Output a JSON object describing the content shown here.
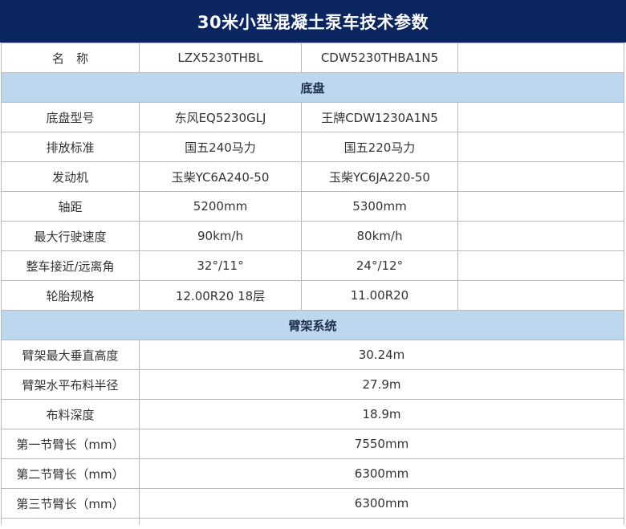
{
  "title": "30米小型混凝土泵车技术参数",
  "header": {
    "name_label": "名　称",
    "model1": "LZX5230THBL",
    "model2": "CDW5230THBA1N5"
  },
  "sections": {
    "chassis": "底盘",
    "boom": "臂架系统"
  },
  "chassis_rows": [
    {
      "label": "底盘型号",
      "v1": "东风EQ5230GLJ",
      "v2": "王牌CDW1230A1N5"
    },
    {
      "label": "排放标准",
      "v1": "国五240马力",
      "v2": "国五220马力"
    },
    {
      "label": "发动机",
      "v1": "玉柴YC6A240-50",
      "v2": "玉柴YC6JA220-50"
    },
    {
      "label": "轴距",
      "v1": "5200mm",
      "v2": "5300mm"
    },
    {
      "label": "最大行驶速度",
      "v1": "90km/h",
      "v2": "80km/h"
    },
    {
      "label": "整车接近/远离角",
      "v1": "32°/11°",
      "v2": "24°/12°"
    },
    {
      "label": "轮胎规格",
      "v1": "12.00R20  18层",
      "v2": "11.00R20"
    }
  ],
  "boom_rows": [
    {
      "label": "臂架最大垂直高度",
      "value": "30.24m"
    },
    {
      "label": "臂架水平布料半径",
      "value": "27.9m"
    },
    {
      "label": "布料深度",
      "value": "18.9m"
    },
    {
      "label": "第一节臂长（mm）",
      "value": "7550mm"
    },
    {
      "label": "第二节臂长（mm）",
      "value": "6300mm"
    },
    {
      "label": "第三节臂长（mm）",
      "value": "6300mm"
    }
  ]
}
